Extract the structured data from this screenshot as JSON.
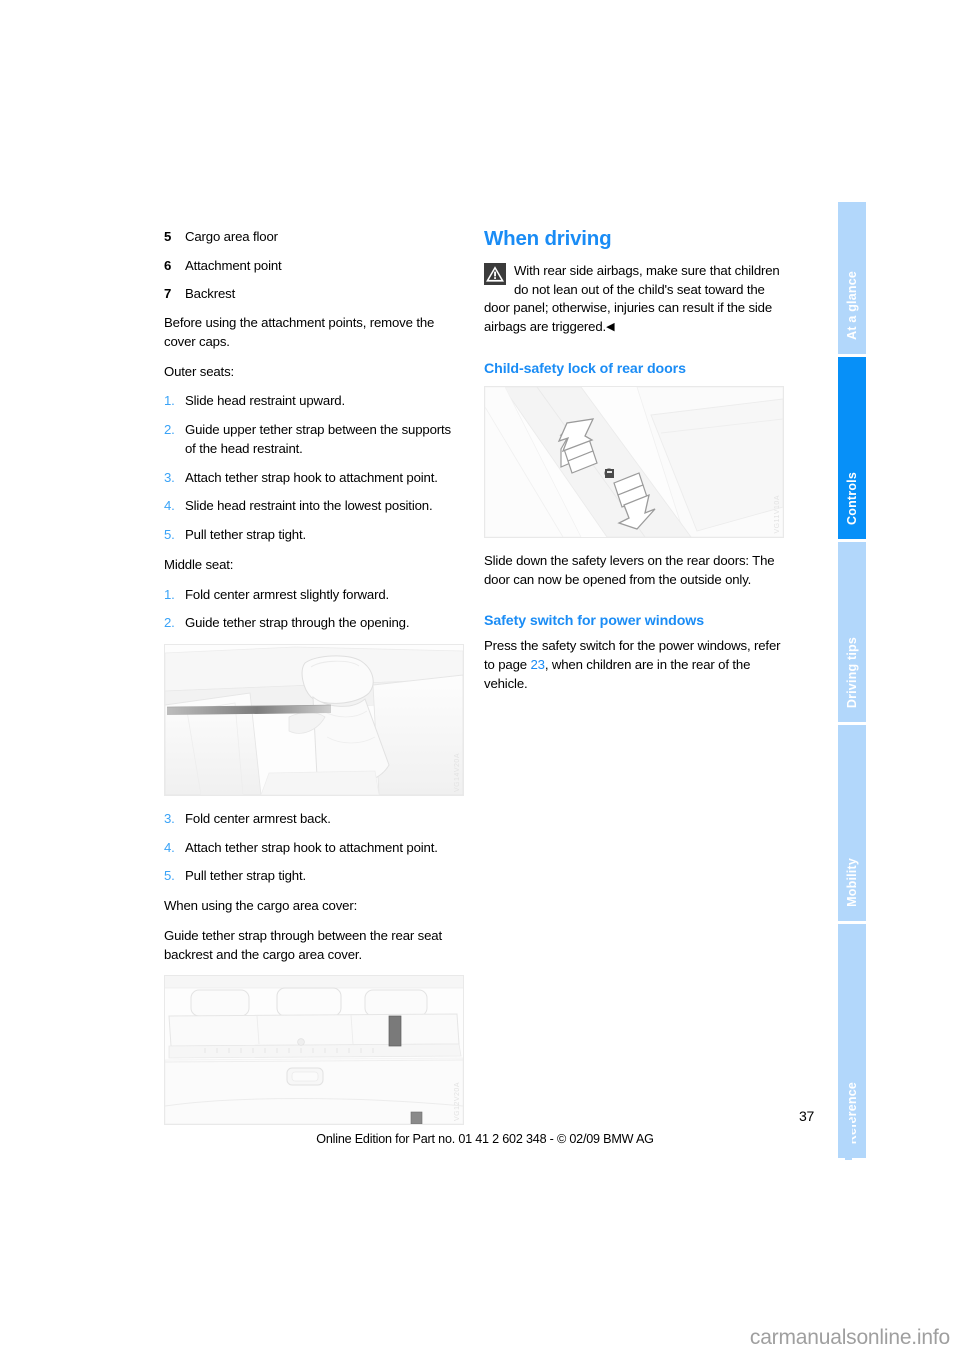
{
  "document": {
    "page_number": "37",
    "footer_line": "Online Edition for Part no. 01 41 2 602 348 - © 02/09 BMW AG",
    "watermark": "carmanualsonline.info"
  },
  "sidebar": {
    "tabs": [
      {
        "label": "At a glance",
        "active": false
      },
      {
        "label": "Controls",
        "active": true
      },
      {
        "label": "Driving tips",
        "active": false
      },
      {
        "label": "Mobility",
        "active": false
      },
      {
        "label": "Reference",
        "active": false
      }
    ],
    "colors": {
      "inactive": "#b2d7fb",
      "active": "#0790f8",
      "label": "#ffffff"
    }
  },
  "theme": {
    "heading_blue": "#1a8cf5",
    "step_number_blue": "#3aa3f7",
    "body_text": "#000000"
  },
  "left_column": {
    "legend": [
      {
        "num": "5",
        "text": "Cargo area floor"
      },
      {
        "num": "6",
        "text": "Attachment point"
      },
      {
        "num": "7",
        "text": "Backrest"
      }
    ],
    "intro_paragraph": "Before using the attachment points, remove the cover caps.",
    "outer_seats_label": "Outer seats:",
    "outer_seats_steps": [
      {
        "num": "1.",
        "text": "Slide head restraint upward."
      },
      {
        "num": "2.",
        "text": "Guide upper tether strap between the supports of the head restraint."
      },
      {
        "num": "3.",
        "text": "Attach tether strap hook to attachment point."
      },
      {
        "num": "4.",
        "text": "Slide head restraint into the lowest position."
      },
      {
        "num": "5.",
        "text": "Pull tether strap tight."
      }
    ],
    "middle_seat_label": "Middle seat:",
    "middle_seat_steps_a": [
      {
        "num": "1.",
        "text": "Fold center armrest slightly forward."
      },
      {
        "num": "2.",
        "text": "Guide tether strap through the opening."
      }
    ],
    "figure_armrest": {
      "caption_code": "VG14V20A",
      "alt": "Rear seat center armrest folded forward with tether strap routed through the opening"
    },
    "middle_seat_steps_b": [
      {
        "num": "3.",
        "text": "Fold center armrest back."
      },
      {
        "num": "4.",
        "text": "Attach tether strap hook to attachment point."
      },
      {
        "num": "5.",
        "text": "Pull tether strap tight."
      }
    ],
    "cargo_cover_label": "When using the cargo area cover:",
    "cargo_cover_paragraph": "Guide tether strap through between the rear seat backrest and the cargo area cover.",
    "figure_cargo": {
      "caption_code": "VG12V20A",
      "alt": "Rear seat backrest viewed from the cargo area with tether strap passing over the cargo area cover"
    }
  },
  "right_column": {
    "heading": "When driving",
    "warning": {
      "icon": "warning-triangle-icon",
      "text": "With rear side airbags, make sure that children do not lean out of the child's seat toward the door panel; otherwise, injuries can result if the side airbags are triggered.",
      "end_mark": "◀"
    },
    "section_child_lock": {
      "heading": "Child-safety lock of rear doors",
      "figure": {
        "caption_code": "VG11V10A",
        "alt": "Rear door jamb showing the child-safety lever with a double arrow indicating sliding direction"
      },
      "paragraph": "Slide down the safety levers on the rear doors: The door can now be opened from the outside only."
    },
    "section_power_windows": {
      "heading": "Safety switch for power windows",
      "paragraph_before": "Press the safety switch for the power windows, refer to page ",
      "page_reference": "23",
      "paragraph_after": ", when children are in the rear of the vehicle."
    }
  }
}
